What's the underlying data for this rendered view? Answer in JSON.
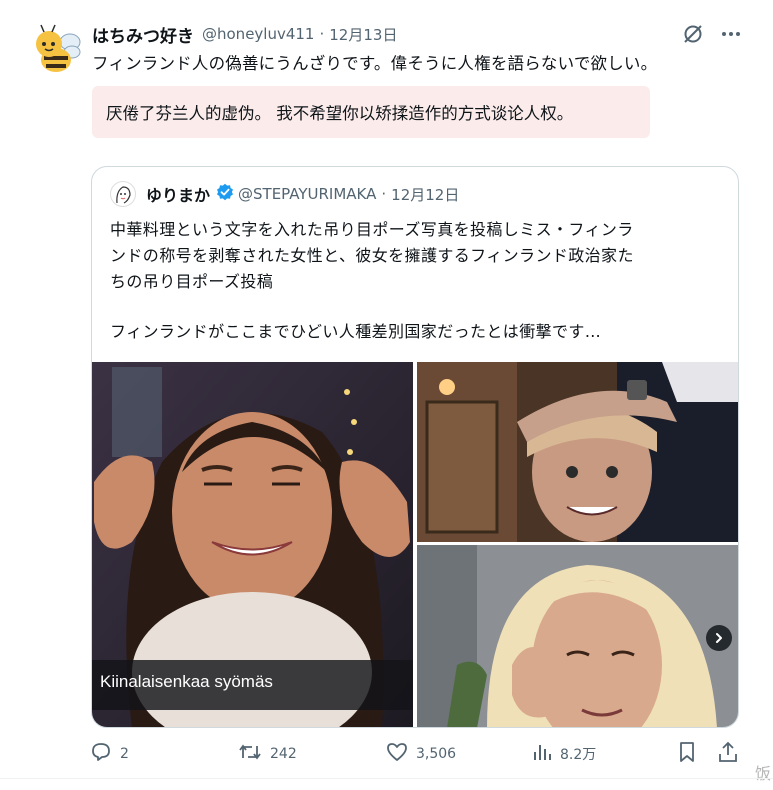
{
  "tweet": {
    "author_name": "はちみつ好き",
    "handle": "@honeyluv411",
    "date": "12月13日",
    "text": "フィンランド人の偽善にうんざりです。偉そうに人権を語らないで欲しい。",
    "translation": "厌倦了芬兰人的虚伪。 我不希望你以矫揉造作的方式谈论人权。"
  },
  "quoted": {
    "author_name": "ゆりまか",
    "handle": "@STEPAYURIMAKA",
    "date": "12月12日",
    "text_line1": "中華料理という文字を入れた吊り目ポーズ写真を投稿しミス・フィンラ",
    "text_line2": "ンドの称号を剥奪された女性と、彼女を擁護するフィンランド政治家た",
    "text_line3": "ちの吊り目ポーズ投稿",
    "text_line4": "フィンランドがここまでひどい人種差別国家だったとは衝撃です…",
    "image_caption": "Kiinalaisenkaa syömäs"
  },
  "actions": {
    "reply_count": "2",
    "retweet_count": "242",
    "like_count": "3,506",
    "view_count": "8.2万"
  },
  "watermark": "饭",
  "icons": {
    "grok": "grok-icon",
    "more": "more-icon",
    "verified": "verified-badge-icon",
    "next": "chevron-right-icon",
    "reply": "reply-icon",
    "retweet": "retweet-icon",
    "like": "heart-icon",
    "views": "views-icon",
    "bookmark": "bookmark-icon",
    "share": "share-icon"
  },
  "colors": {
    "text": "#0f1419",
    "muted": "#536471",
    "verified": "#1d9bf0",
    "translation_bg": "#fbeceb",
    "border": "#cfd9de"
  }
}
